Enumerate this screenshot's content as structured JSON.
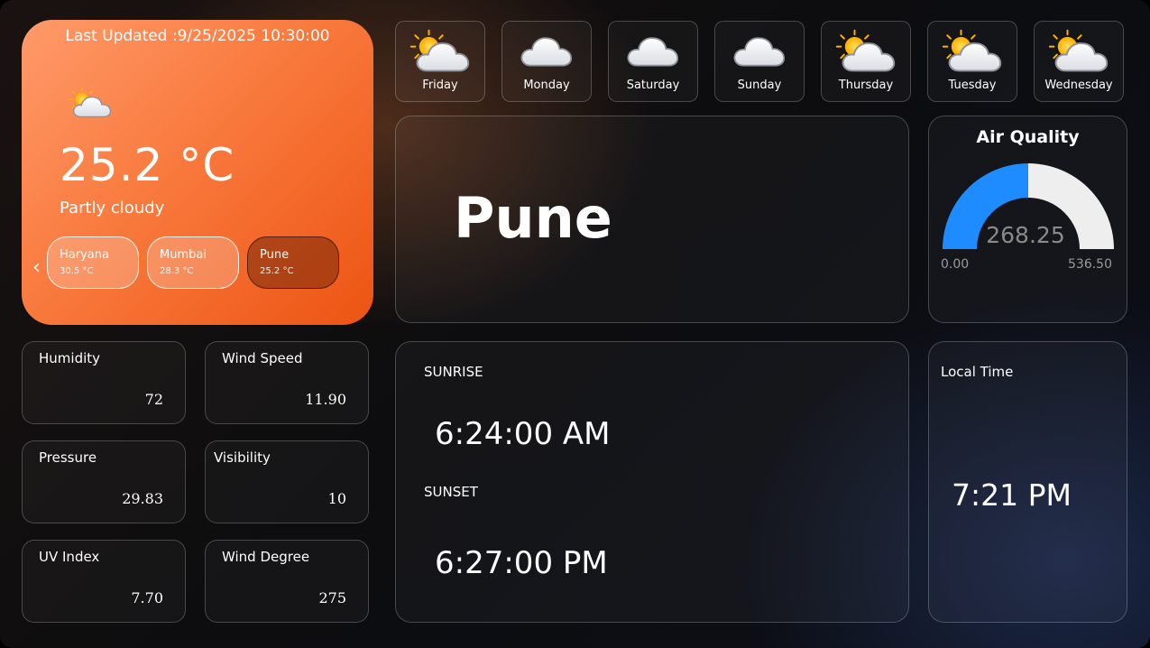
{
  "main": {
    "last_updated": "Last Updated :9/25/2025 10:30:00",
    "icon": "partly-cloudy-icon",
    "temperature": "25.2 °C",
    "condition": "Partly cloudy",
    "cities": [
      {
        "name": "Haryana",
        "temp": "30.5 °C"
      },
      {
        "name": "Mumbai",
        "temp": "28.3 °C"
      },
      {
        "name": "Pune",
        "temp": "25.2 °C"
      }
    ]
  },
  "forecast": [
    {
      "day": "Friday",
      "icon": "partly-cloudy-icon"
    },
    {
      "day": "Monday",
      "icon": "cloud-icon"
    },
    {
      "day": "Saturday",
      "icon": "cloud-icon"
    },
    {
      "day": "Sunday",
      "icon": "cloud-icon"
    },
    {
      "day": "Thursday",
      "icon": "partly-cloudy-icon"
    },
    {
      "day": "Tuesday",
      "icon": "partly-cloudy-icon"
    },
    {
      "day": "Wednesday",
      "icon": "partly-cloudy-icon"
    }
  ],
  "city_card": {
    "name": "Pune"
  },
  "air_quality": {
    "title": "Air Quality",
    "value": 268.25,
    "value_text": "268.25",
    "min": 0,
    "max": 536.5,
    "min_text": "0.00",
    "max_text": "536.50",
    "fill_color": "#1e8bff",
    "track_color": "#eeeeee"
  },
  "stats": [
    {
      "label": "Humidity",
      "value": "72"
    },
    {
      "label": "Wind Speed",
      "value": "11.90"
    },
    {
      "label": "Pressure",
      "value": "29.83"
    },
    {
      "label": "Visibility",
      "value": "10"
    },
    {
      "label": "UV Index",
      "value": "7.70"
    },
    {
      "label": "Wind Degree",
      "value": "275"
    }
  ],
  "sun": {
    "sunrise_label": "SUNRISE",
    "sunrise_time": "6:24:00 AM",
    "sunset_label": "SUNSET",
    "sunset_time": "6:27:00 PM"
  },
  "local_time": {
    "label": "Local Time",
    "value": "7:21 PM"
  },
  "colors": {
    "main_card_start": "#ff9a6a",
    "main_card_end": "#ec5412",
    "sun": "#ffc21a",
    "cloud": "#f2f2f2"
  }
}
